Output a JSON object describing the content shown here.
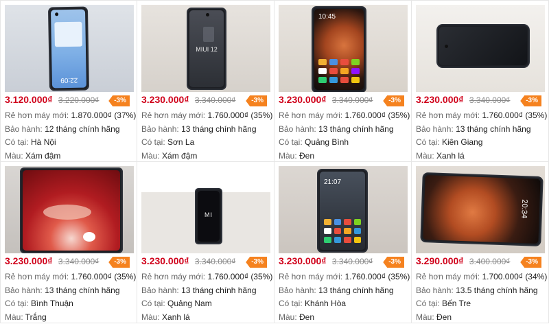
{
  "labels": {
    "cheaper_prefix": "Rẻ hơn máy mới: ",
    "warranty_prefix": "Bảo hành: ",
    "location_prefix": "Có tại: ",
    "color_prefix": "Màu: "
  },
  "products": [
    {
      "price": "3.120.000₫",
      "old_price": "3.220.000₫",
      "discount": "-3%",
      "cheaper": "1.870.000₫ (37%)",
      "warranty": "12 tháng chính hãng",
      "location": "Hà Nội",
      "color": "Xám đậm",
      "screen_text": "22:09"
    },
    {
      "price": "3.230.000₫",
      "old_price": "3.340.000₫",
      "discount": "-3%",
      "cheaper": "1.760.000₫ (35%)",
      "warranty": "13 tháng chính hãng",
      "location": "Sơn La",
      "color": "Xám đậm",
      "screen_text": "MIUI 12"
    },
    {
      "price": "3.230.000₫",
      "old_price": "3.340.000₫",
      "discount": "-3%",
      "cheaper": "1.760.000₫ (35%)",
      "warranty": "13 tháng chính hãng",
      "location": "Quảng Bình",
      "color": "Đen",
      "screen_text": "10:45"
    },
    {
      "price": "3.230.000₫",
      "old_price": "3.340.000₫",
      "discount": "-3%",
      "cheaper": "1.760.000₫ (35%)",
      "warranty": "13 tháng chính hãng",
      "location": "Kiên Giang",
      "color": "Xanh lá",
      "screen_text": ""
    },
    {
      "price": "3.230.000₫",
      "old_price": "3.340.000₫",
      "discount": "-3%",
      "cheaper": "1.760.000₫ (35%)",
      "warranty": "13 tháng chính hãng",
      "location": "Bình Thuận",
      "color": "Trắng",
      "screen_text": ""
    },
    {
      "price": "3.230.000₫",
      "old_price": "3.340.000₫",
      "discount": "-3%",
      "cheaper": "1.760.000₫ (35%)",
      "warranty": "13 tháng chính hãng",
      "location": "Quảng Nam",
      "color": "Xanh lá",
      "screen_text": "MI"
    },
    {
      "price": "3.230.000₫",
      "old_price": "3.340.000₫",
      "discount": "-3%",
      "cheaper": "1.760.000₫ (35%)",
      "warranty": "13 tháng chính hãng",
      "location": "Khánh Hòa",
      "color": "Đen",
      "screen_text": "21:07"
    },
    {
      "price": "3.290.000₫",
      "old_price": "3.400.000₫",
      "discount": "-3%",
      "cheaper": "1.700.000₫ (34%)",
      "warranty": "13.5 tháng chính hãng",
      "location": "Bến Tre",
      "color": "Đen",
      "screen_text": "20:34"
    }
  ],
  "colors": {
    "price": "#d0021b",
    "discount_badge": "#f5821f",
    "muted_text": "#666666",
    "border": "#e6e6e6"
  }
}
